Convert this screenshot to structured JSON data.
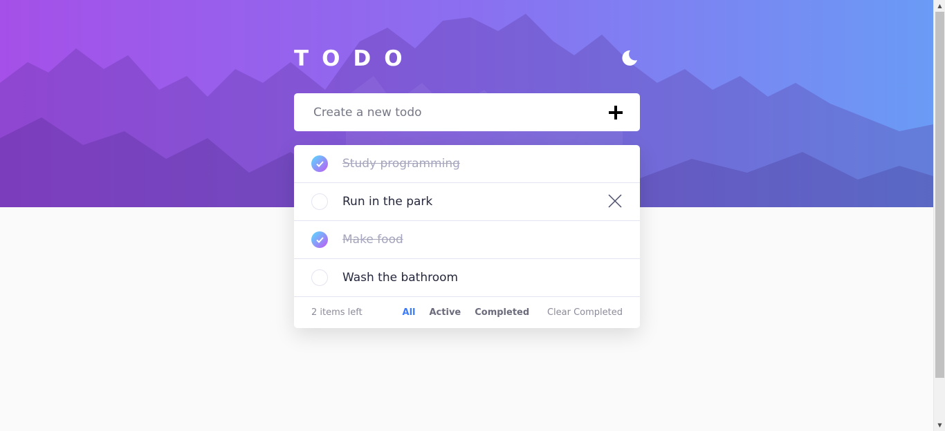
{
  "app": {
    "title": "TODO"
  },
  "input": {
    "placeholder": "Create a new todo"
  },
  "todos": [
    {
      "text": "Study programming",
      "completed": true
    },
    {
      "text": "Run in the park",
      "completed": false
    },
    {
      "text": "Make food",
      "completed": true
    },
    {
      "text": "Wash the bathroom",
      "completed": false
    }
  ],
  "footer": {
    "items_left": "2 items left",
    "filter_all": "All",
    "filter_active": "Active",
    "filter_completed": "Completed",
    "active_filter": "All",
    "clear": "Clear Completed"
  },
  "icons": {
    "theme": "moon-icon",
    "add": "plus-icon",
    "check": "check-icon",
    "delete": "close-icon"
  },
  "colors": {
    "gradient_start": "#a550e8",
    "gradient_end": "#6a9bf5",
    "check_start": "#55ddff",
    "check_end": "#c058f3",
    "active_filter": "#3a7cfd",
    "background": "#fafafa"
  }
}
